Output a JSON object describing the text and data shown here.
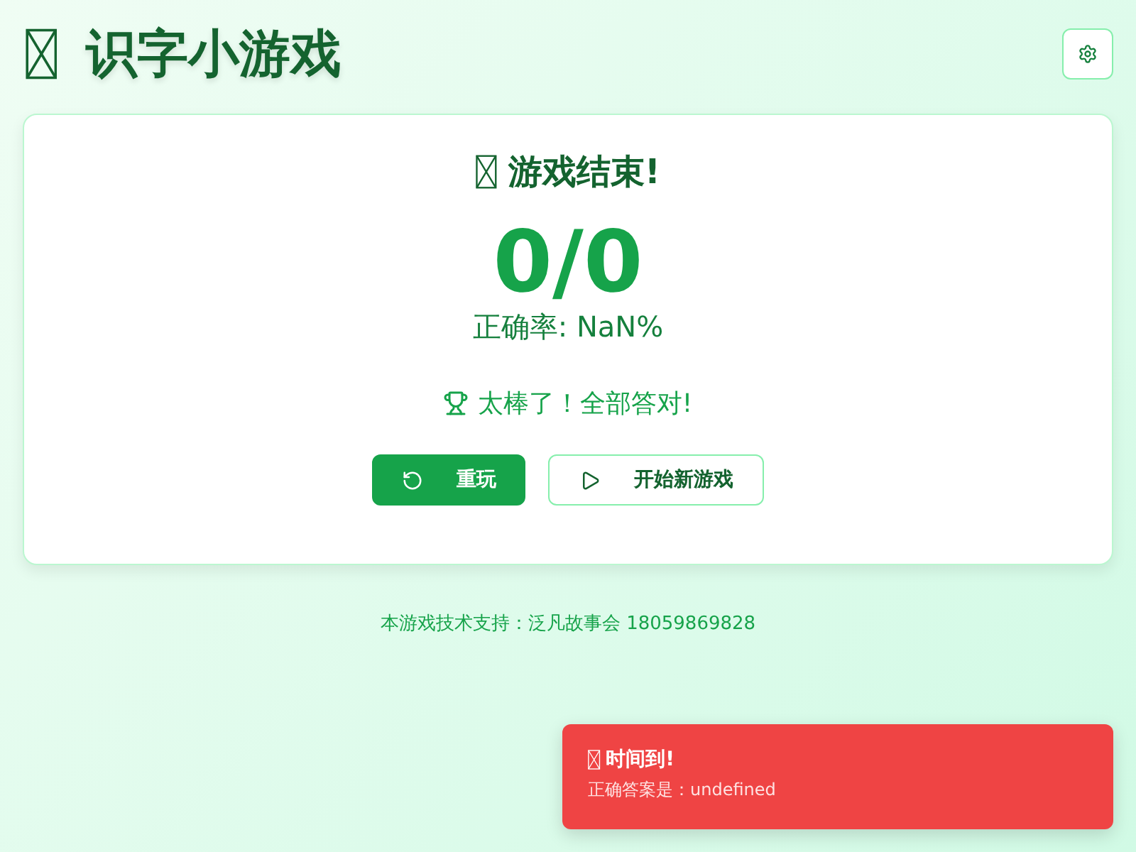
{
  "header": {
    "title": "识字小游戏"
  },
  "result": {
    "title": "游戏结束!",
    "score": "0/0",
    "accuracy": "正确率: NaN%",
    "message": "太棒了！全部答对!"
  },
  "buttons": [
    {
      "label": "重玩",
      "kind": "replay",
      "primary": true
    },
    {
      "label": "开始新游戏",
      "kind": "play",
      "primary": false
    }
  ],
  "footer": "本游戏技术支持：泛凡故事会 18059869828",
  "toast": {
    "title": "时间到!",
    "message": "正确答案是：undefined"
  }
}
